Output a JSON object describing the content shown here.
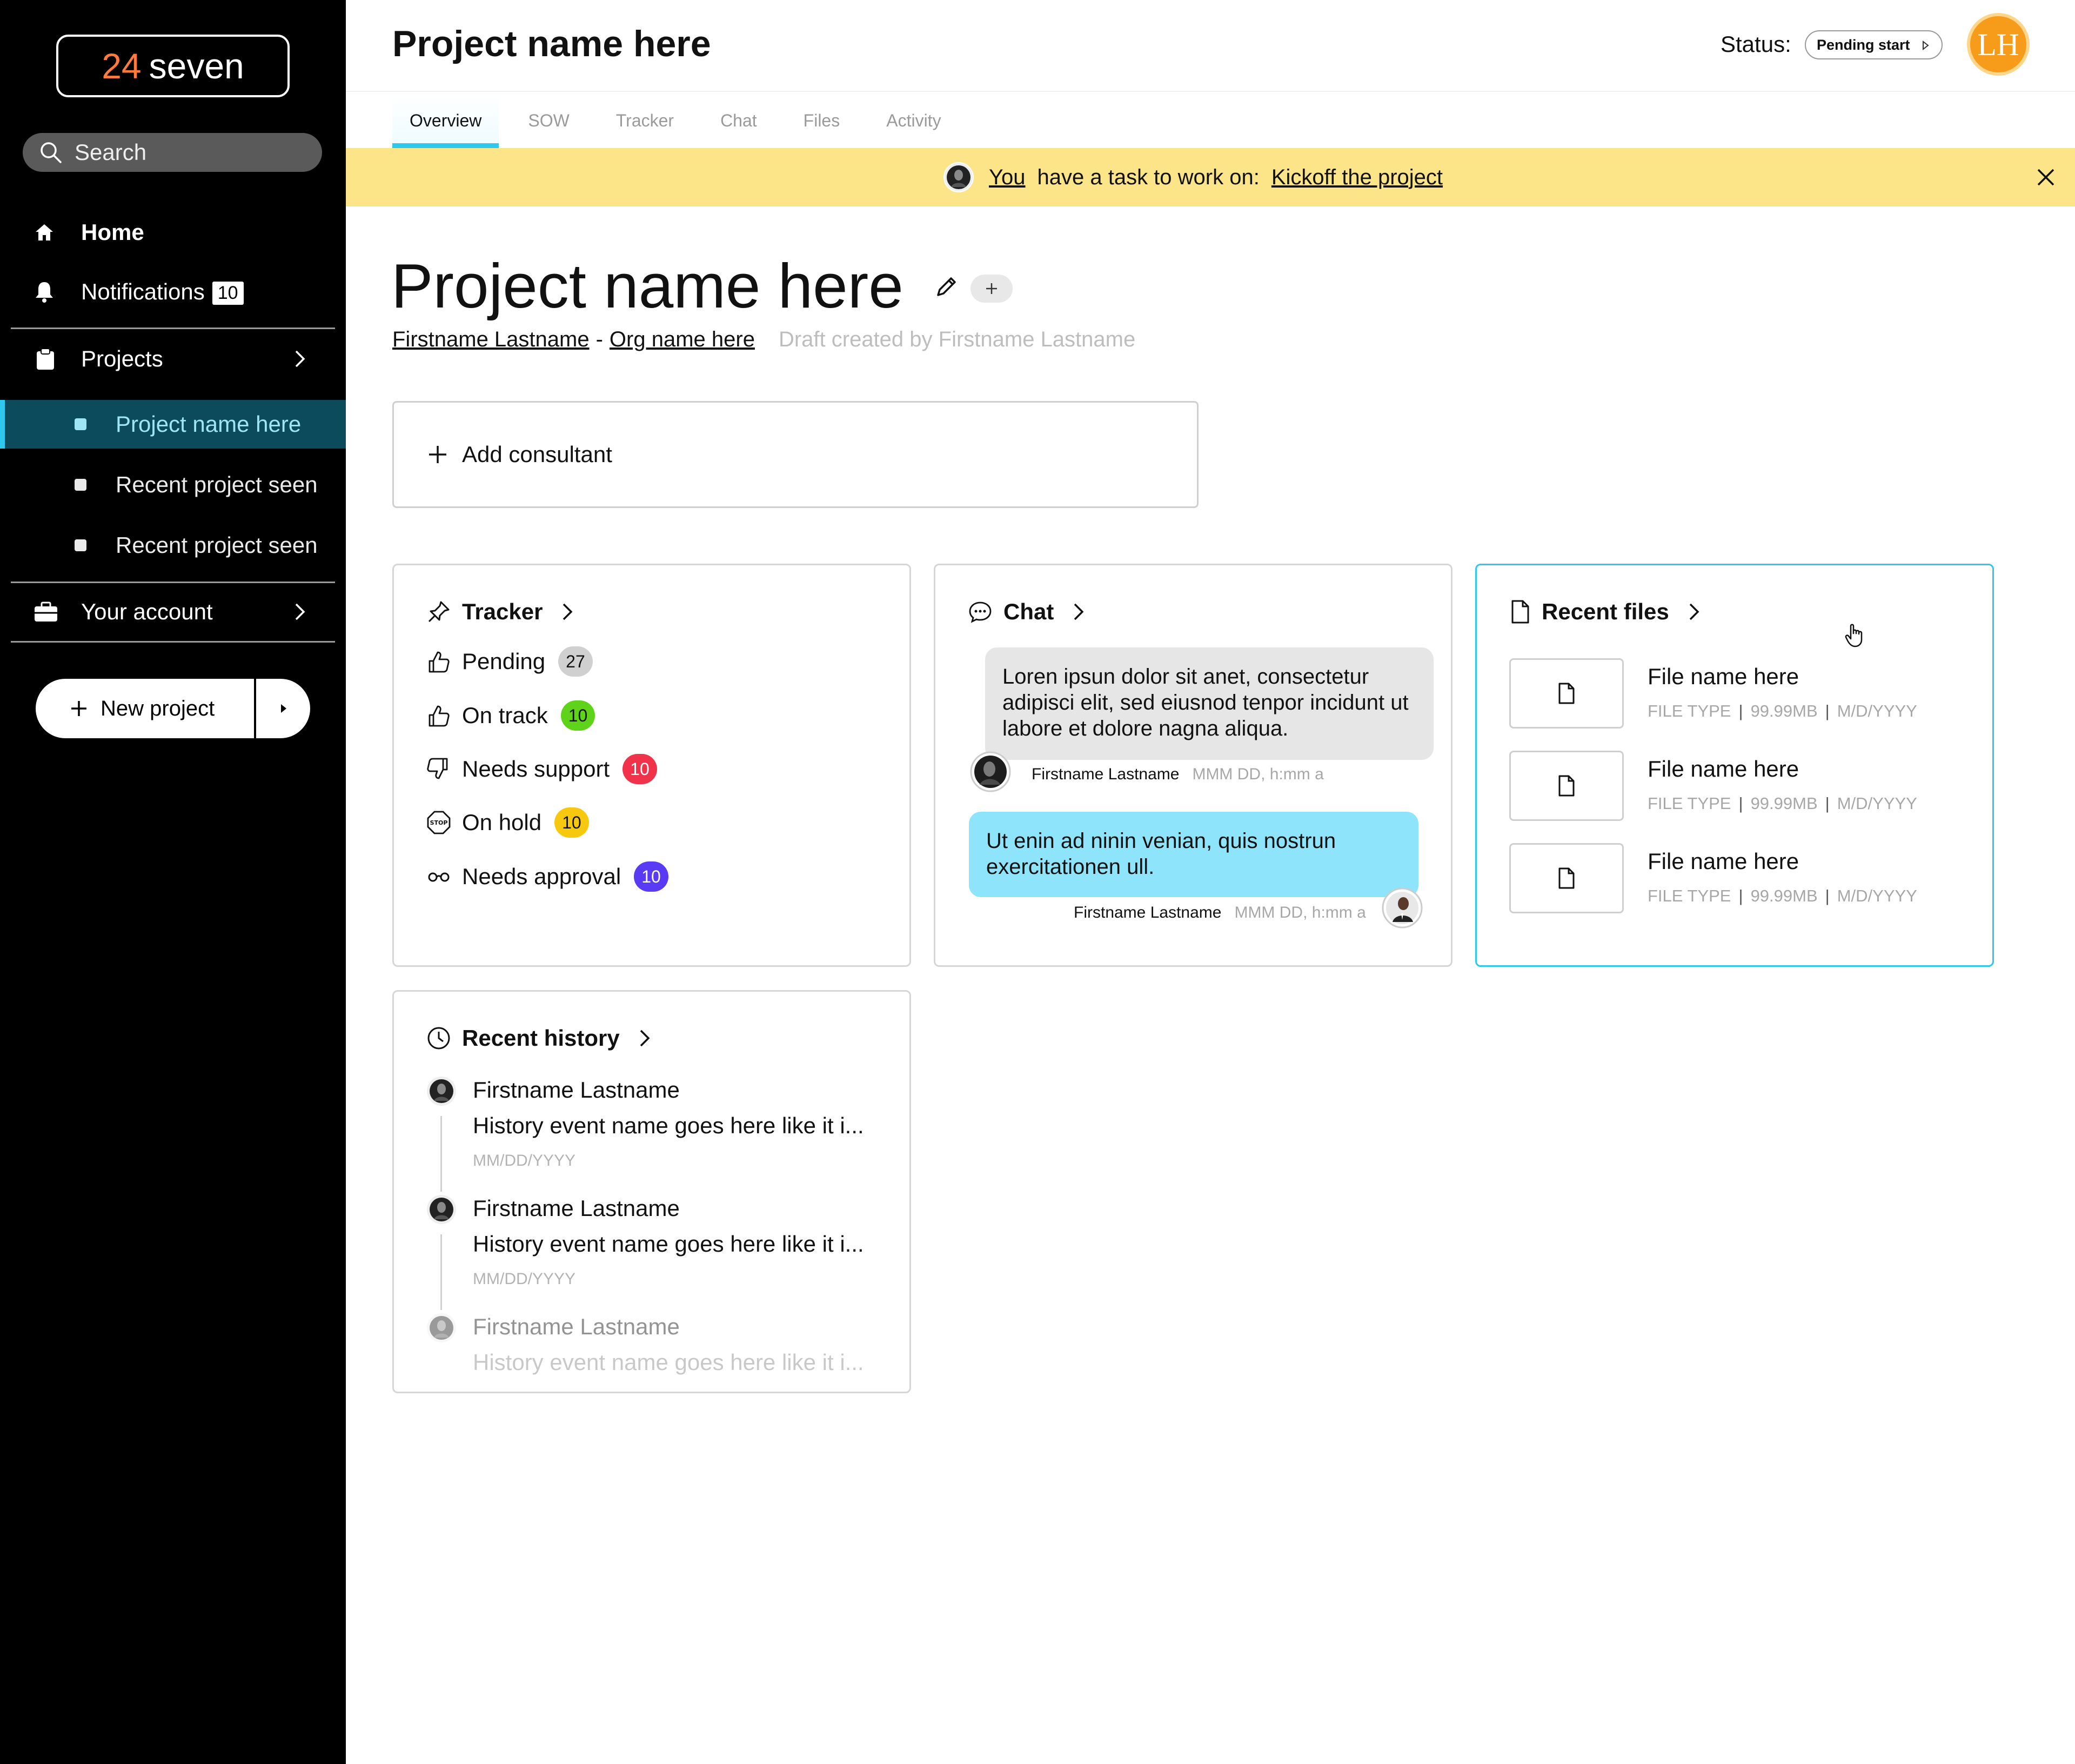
{
  "brand": {
    "num": "24",
    "word": "seven",
    "accent": "#ff7a3c"
  },
  "sidebar": {
    "search_placeholder": "Search",
    "home": "Home",
    "notifications": {
      "label": "Notifications",
      "count": "10"
    },
    "projects": "Projects",
    "project_items": [
      "Project name here",
      "Recent project seen",
      "Recent project seen"
    ],
    "account": "Your account",
    "new_project": "New project"
  },
  "header": {
    "title": "Project name here",
    "status_label": "Status:",
    "status_value": "Pending start",
    "avatar_initials": "LH"
  },
  "tabs": [
    "Overview",
    "SOW",
    "Tracker",
    "Chat",
    "Files",
    "Activity"
  ],
  "banner": {
    "you": "You",
    "text": "have a task to work on:",
    "task": "Kickoff the project"
  },
  "project": {
    "title": "Project name here",
    "owner": "Firstname Lastname",
    "sep": "-",
    "org": "Org name here",
    "draft": "Draft created by Firstname Lastname",
    "add_consultant": "Add consultant"
  },
  "tracker": {
    "title": "Tracker",
    "rows": [
      {
        "label": "Pending",
        "count": "27",
        "color": "#d0d0d0"
      },
      {
        "label": "On track",
        "count": "10",
        "color": "#5fd31a"
      },
      {
        "label": "Needs support",
        "count": "10",
        "color": "#f0334a"
      },
      {
        "label": "On hold",
        "count": "10",
        "color": "#f6c90e"
      },
      {
        "label": "Needs approval",
        "count": "10",
        "color": "#5a3bf5"
      }
    ]
  },
  "chat": {
    "title": "Chat",
    "messages": [
      {
        "text": "Loren ipsun dolor sit anet, consectetur adipisci elit, sed eiusnod tenpor incidunt ut labore et dolore nagna aliqua.",
        "author": "Firstname Lastname",
        "time": "MMM DD, h:mm a"
      },
      {
        "text": "Ut enin ad ninin venian, quis nostrun exercitationen ull.",
        "author": "Firstname Lastname",
        "time": "MMM DD, h:mm a"
      }
    ]
  },
  "files": {
    "title": "Recent files",
    "items": [
      {
        "name": "File name here",
        "type": "FILE TYPE",
        "size": "99.99MB",
        "date": "M/D/YYYY"
      },
      {
        "name": "File name here",
        "type": "FILE TYPE",
        "size": "99.99MB",
        "date": "M/D/YYYY"
      },
      {
        "name": "File name here",
        "type": "FILE TYPE",
        "size": "99.99MB",
        "date": "M/D/YYYY"
      }
    ]
  },
  "history": {
    "title": "Recent history",
    "items": [
      {
        "name": "Firstname Lastname",
        "event": "History event name goes here like it i...",
        "date": "MM/DD/YYYY"
      },
      {
        "name": "Firstname Lastname",
        "event": "History event name goes here like it i...",
        "date": "MM/DD/YYYY"
      },
      {
        "name": "Firstname Lastname",
        "event": "History event name goes here like it i...",
        "date": ""
      }
    ]
  }
}
